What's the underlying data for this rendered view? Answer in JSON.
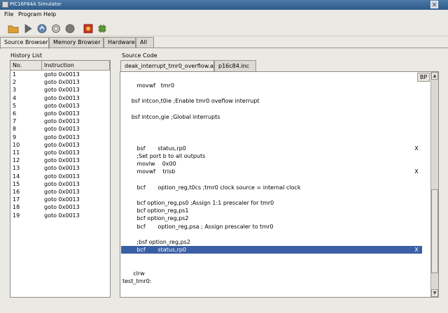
{
  "window": {
    "title": "PIC16F84A Simulator",
    "close_glyph": "×"
  },
  "menu": [
    {
      "label": "File"
    },
    {
      "label": "Program"
    },
    {
      "label": "Help"
    }
  ],
  "toolbar": [
    {
      "icon": "open-folder-icon"
    },
    {
      "icon": "run-icon"
    },
    {
      "icon": "step-over-icon"
    },
    {
      "icon": "reset-icon"
    },
    {
      "icon": "stop-icon"
    },
    {
      "icon": "breakpoint-icon"
    },
    {
      "icon": "chip-icon"
    }
  ],
  "tabs": [
    {
      "label": "Source Browser",
      "active": true
    },
    {
      "label": "Memory Browser",
      "active": false
    },
    {
      "label": "Hardware",
      "active": false
    },
    {
      "label": "All",
      "active": false
    }
  ],
  "history": {
    "label": "History List",
    "columns": [
      "No.",
      "Instruction"
    ],
    "rows": [
      [
        "1",
        "goto 0x0013"
      ],
      [
        "2",
        "goto 0x0013"
      ],
      [
        "3",
        "goto 0x0013"
      ],
      [
        "4",
        "goto 0x0013"
      ],
      [
        "5",
        "goto 0x0013"
      ],
      [
        "6",
        "goto 0x0013"
      ],
      [
        "7",
        "goto 0x0013"
      ],
      [
        "8",
        "goto 0x0013"
      ],
      [
        "9",
        "goto 0x0013"
      ],
      [
        "10",
        "goto 0x0013"
      ],
      [
        "11",
        "goto 0x0013"
      ],
      [
        "12",
        "goto 0x0013"
      ],
      [
        "13",
        "goto 0x0013"
      ],
      [
        "14",
        "goto 0x0013"
      ],
      [
        "15",
        "goto 0x0013"
      ],
      [
        "16",
        "goto 0x0013"
      ],
      [
        "17",
        "goto 0x0013"
      ],
      [
        "18",
        "goto 0x0013"
      ],
      [
        "19",
        "goto 0x0013"
      ]
    ]
  },
  "source": {
    "label": "Source Code",
    "tabs": [
      {
        "label": "deak_interrupt_tmr0_overflow.asm",
        "active": true
      },
      {
        "label": "p16c84.inc",
        "active": false
      }
    ],
    "bp_header": "BP",
    "lines": [
      {
        "text": "        movwf   tmr0",
        "bp": ""
      },
      {
        "text": "",
        "bp": ""
      },
      {
        "text": "     bsf intcon,t0ie ;Enable tmr0 oveflow interrupt",
        "bp": ""
      },
      {
        "text": "",
        "bp": ""
      },
      {
        "text": "     bsf intcon,gie ;Global interrupts",
        "bp": ""
      },
      {
        "text": "",
        "bp": ""
      },
      {
        "text": "",
        "bp": ""
      },
      {
        "text": "",
        "bp": ""
      },
      {
        "text": "        bsf       status,rp0",
        "bp": "X"
      },
      {
        "text": "        ;Set port b to all outputs",
        "bp": ""
      },
      {
        "text": "        movlw    0x00",
        "bp": ""
      },
      {
        "text": "        movwf    trisb",
        "bp": "X"
      },
      {
        "text": "",
        "bp": ""
      },
      {
        "text": "        bcf       option_reg,t0cs ;tmr0 clock source = internal clock",
        "bp": ""
      },
      {
        "text": "",
        "bp": ""
      },
      {
        "text": "        bcf option_reg,ps0 ;Assign 1:1 prescaler for tmr0",
        "bp": ""
      },
      {
        "text": "        bcf option_reg,ps1",
        "bp": ""
      },
      {
        "text": "        bcf option_reg,ps2",
        "bp": ""
      },
      {
        "text": "        bcf       option_reg,psa ; Assign prescaler to tmr0",
        "bp": ""
      },
      {
        "text": "",
        "bp": ""
      },
      {
        "text": "        ;bsf option_reg,ps2",
        "bp": ""
      },
      {
        "text": "        bcf       status,rp0",
        "bp": "X",
        "selected": true
      },
      {
        "text": "",
        "bp": ""
      },
      {
        "text": "",
        "bp": ""
      },
      {
        "text": "      clrw",
        "bp": ""
      },
      {
        "text": "test_tmr0:",
        "bp": ""
      }
    ]
  },
  "scroll": {
    "up": "▲",
    "down": "▼"
  }
}
